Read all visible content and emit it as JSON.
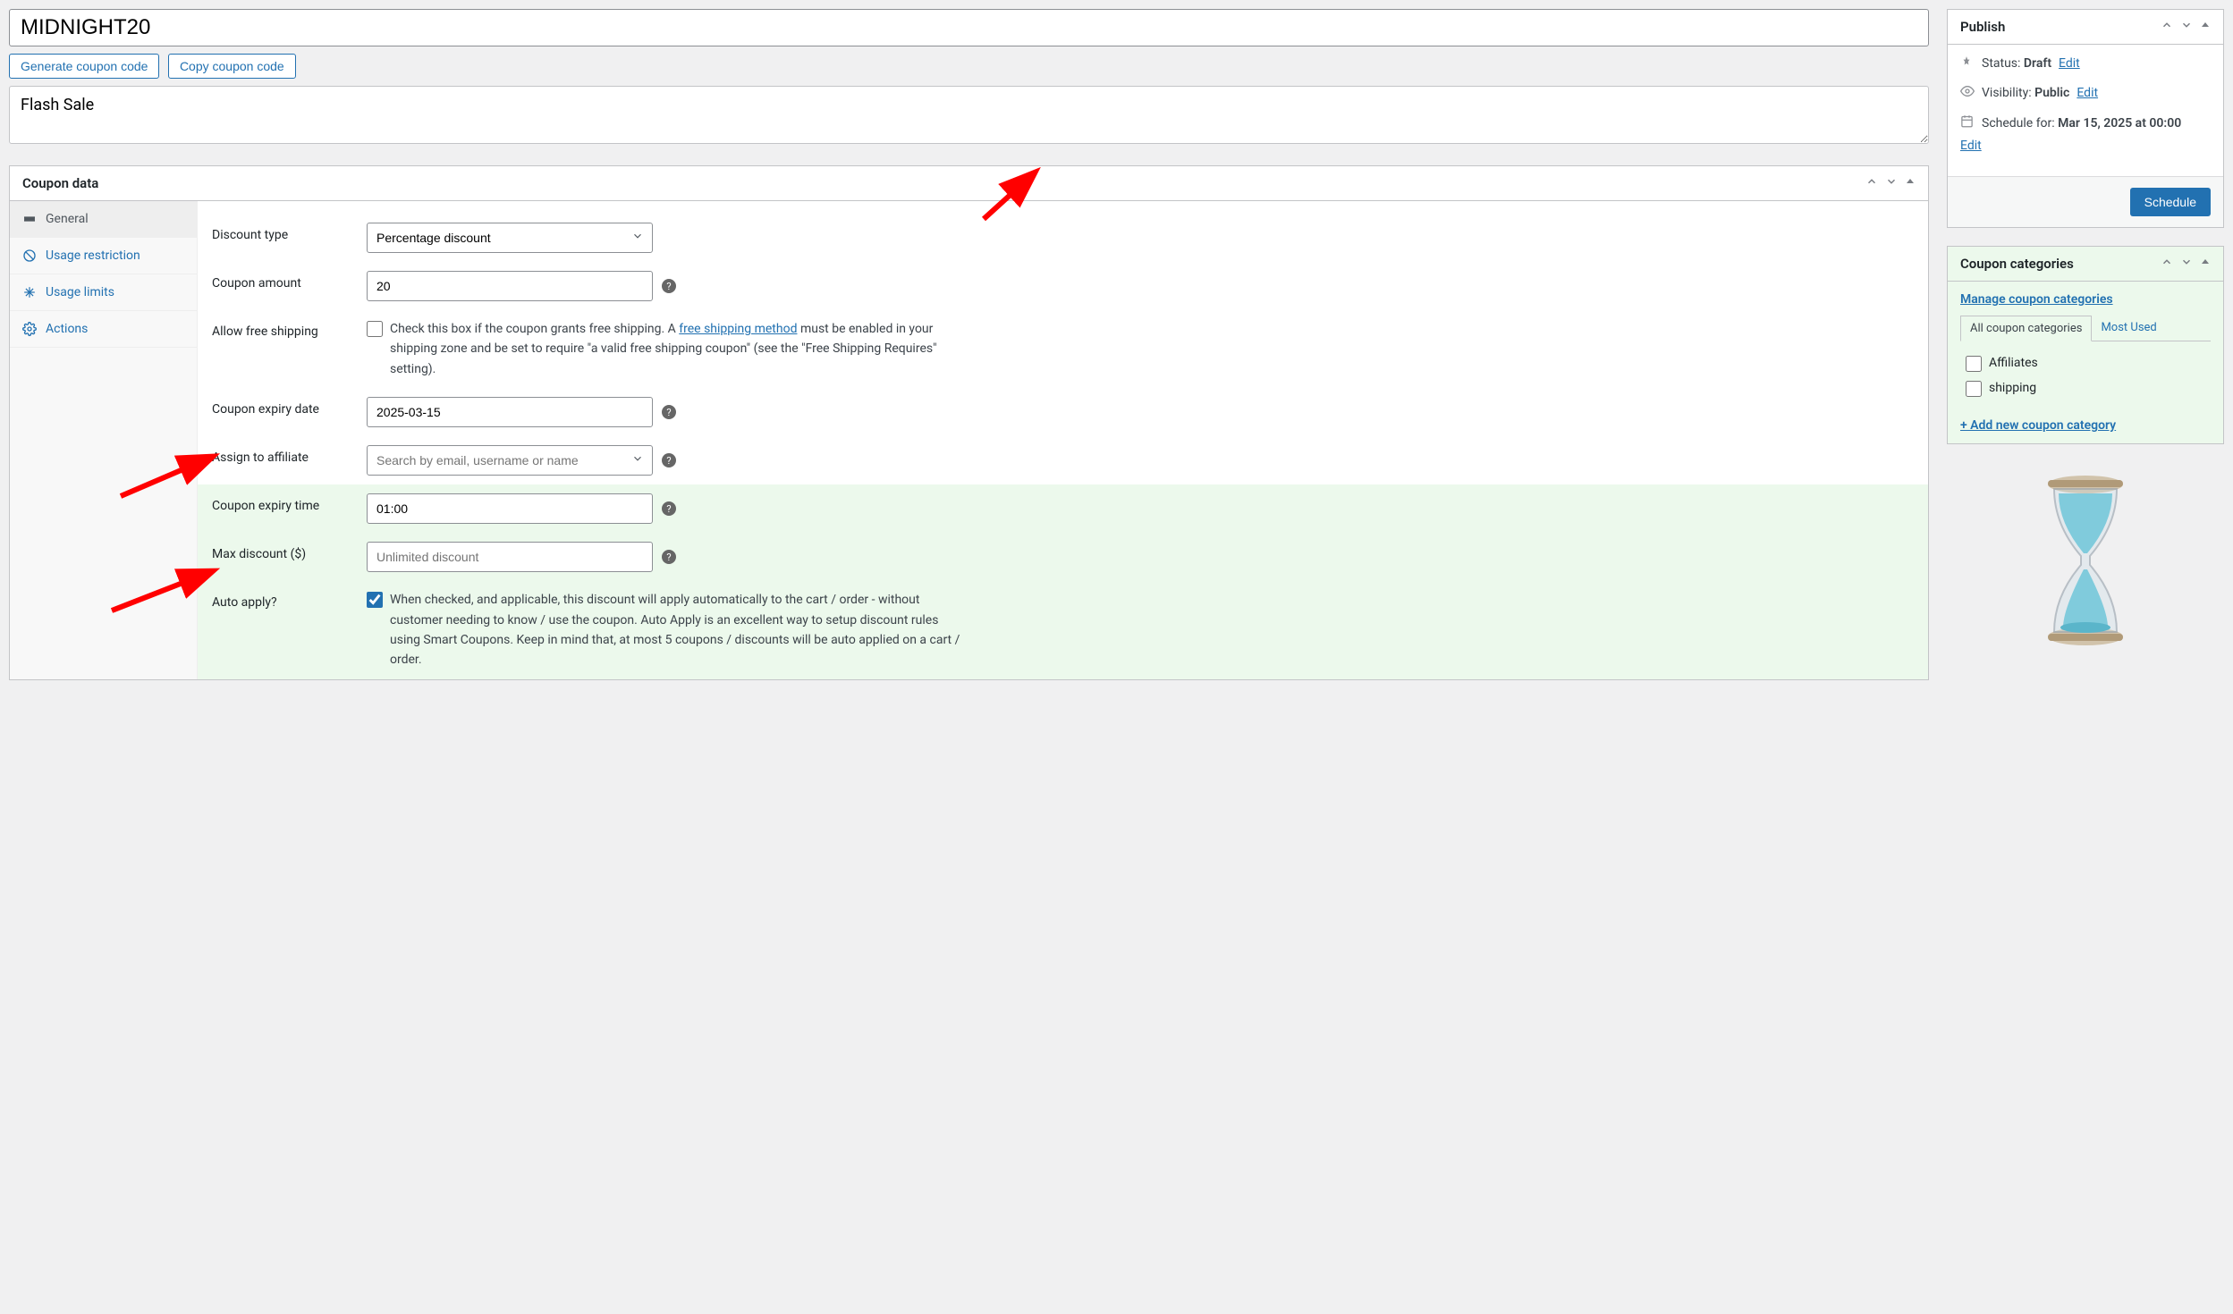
{
  "title": {
    "value": "MIDNIGHT20"
  },
  "buttons": {
    "generate": "Generate coupon code",
    "copy": "Copy coupon code"
  },
  "description": {
    "value": "Flash Sale"
  },
  "coupon_data": {
    "panel_title": "Coupon data",
    "tabs": {
      "general": "General",
      "usage_restriction": "Usage restriction",
      "usage_limits": "Usage limits",
      "actions": "Actions"
    },
    "fields": {
      "discount_type": {
        "label": "Discount type",
        "value": "Percentage discount"
      },
      "coupon_amount": {
        "label": "Coupon amount",
        "value": "20"
      },
      "free_shipping": {
        "label": "Allow free shipping",
        "checked": false,
        "desc_pre": " Check this box if the coupon grants free shipping. A ",
        "desc_link": "free shipping method",
        "desc_post": " must be enabled in your shipping zone and be set to require \"a valid free shipping coupon\" (see the \"Free Shipping Requires\" setting)."
      },
      "expiry_date": {
        "label": "Coupon expiry date",
        "value": "2025-03-15"
      },
      "assign_affiliate": {
        "label": "Assign to affiliate",
        "placeholder": "Search by email, username or name"
      },
      "expiry_time": {
        "label": "Coupon expiry time",
        "value": "01:00"
      },
      "max_discount": {
        "label": "Max discount ($)",
        "placeholder": "Unlimited discount"
      },
      "auto_apply": {
        "label": "Auto apply?",
        "checked": true,
        "desc": " When checked, and applicable, this discount will apply automatically to the cart / order - without customer needing to know / use the coupon. Auto Apply is an excellent way to setup discount rules using Smart Coupons. Keep in mind that, at most 5 coupons / discounts will be auto applied on a cart / order."
      }
    }
  },
  "publish": {
    "title": "Publish",
    "status_label": "Status: ",
    "status_value": "Draft",
    "visibility_label": "Visibility: ",
    "visibility_value": "Public",
    "schedule_label": "Schedule for: ",
    "schedule_value": "Mar 15, 2025 at 00:00",
    "edit": "Edit",
    "button": "Schedule"
  },
  "categories": {
    "title": "Coupon categories",
    "manage_link": "Manage coupon categories",
    "tab_all": "All coupon categories",
    "tab_most": "Most Used",
    "items": [
      "Affiliates",
      "shipping"
    ],
    "add_link": "+ Add new coupon category"
  }
}
